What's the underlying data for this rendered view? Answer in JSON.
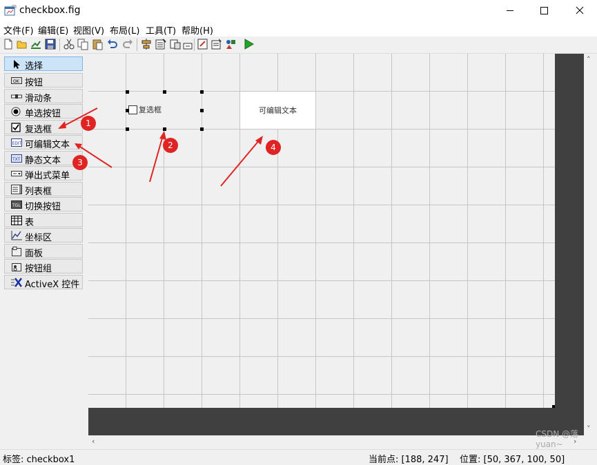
{
  "window": {
    "title": "checkbox.fig",
    "app_icon": "figure-window-icon",
    "controls": [
      "minimize-icon",
      "maximize-icon",
      "close-icon"
    ]
  },
  "menu": {
    "items": [
      "文件(F)",
      "编辑(E)",
      "视图(V)",
      "布局(L)",
      "工具(T)",
      "帮助(H)"
    ]
  },
  "toolbar": {
    "buttons": [
      "new-icon",
      "open-icon",
      "save-icon",
      "cut-icon",
      "copy-icon",
      "paste-icon",
      "undo-icon",
      "redo-icon",
      "align-icon",
      "menu-editor-icon",
      "tab-order-icon",
      "toolbar-editor-icon",
      "editor-icon",
      "property-inspector-icon",
      "object-browser-icon",
      "run-icon"
    ]
  },
  "palette": {
    "items": [
      {
        "label": "选择",
        "icon": "cursor-arrow-icon",
        "selected": true
      },
      {
        "label": "按钮",
        "icon": "push-button-icon"
      },
      {
        "label": "滑动条",
        "icon": "slider-icon"
      },
      {
        "label": "单选按钮",
        "icon": "radio-button-icon"
      },
      {
        "label": "复选框",
        "icon": "checkbox-icon"
      },
      {
        "label": "可编辑文本",
        "icon": "edit-text-icon"
      },
      {
        "label": "静态文本",
        "icon": "static-text-icon"
      },
      {
        "label": "弹出式菜单",
        "icon": "popup-menu-icon"
      },
      {
        "label": "列表框",
        "icon": "listbox-icon"
      },
      {
        "label": "切换按钮",
        "icon": "toggle-button-icon"
      },
      {
        "label": "表",
        "icon": "table-icon"
      },
      {
        "label": "坐标区",
        "icon": "axes-icon"
      },
      {
        "label": "面板",
        "icon": "panel-icon"
      },
      {
        "label": "按钮组",
        "icon": "button-group-icon"
      },
      {
        "label": "ActiveX 控件",
        "icon": "activex-icon"
      }
    ]
  },
  "canvas": {
    "checkbox_label": "复选框",
    "edit_text": "可编辑文本"
  },
  "annotations": {
    "badges": [
      "1",
      "2",
      "3",
      "4"
    ],
    "color": "#e02424"
  },
  "status": {
    "tag": "标签: checkbox1",
    "current_point": "当前点:  [188, 247]",
    "position": "位置: [50, 367, 100, 50]"
  },
  "watermark": "CSDN @落yuan~"
}
